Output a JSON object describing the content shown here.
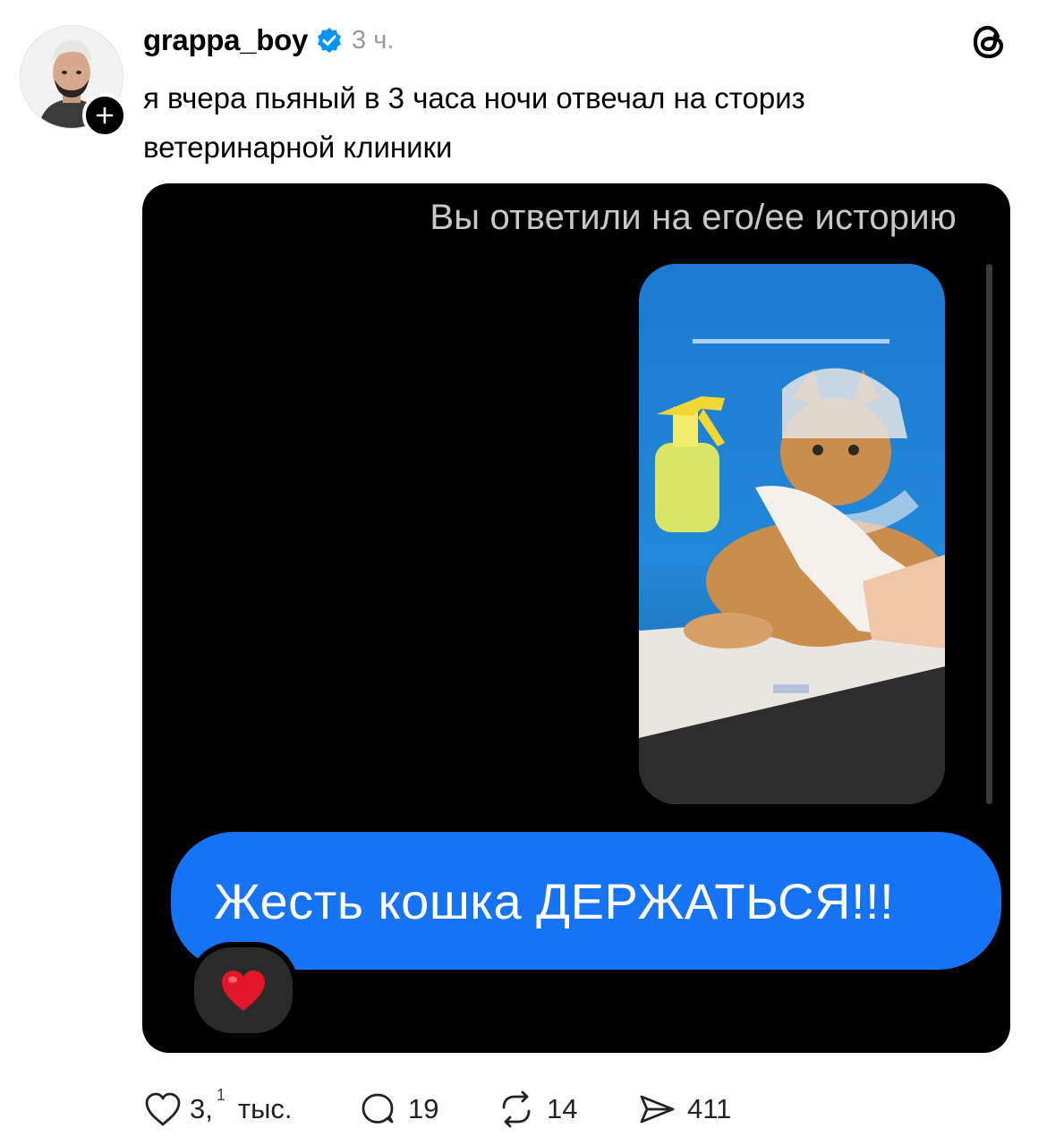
{
  "post": {
    "username": "grappa_boy",
    "time": "3 ч.",
    "text": "я вчера пьяный в 3 часа ночи отвечал на сториз ветеринарной клиники"
  },
  "media": {
    "header": "Вы ответили на его/ее историю",
    "reply": "Жесть кошка ДЕРЖАТЬСЯ!!!"
  },
  "actions": {
    "likes_main": "3,",
    "likes_sup": "1",
    "likes_unit": "тыс.",
    "comments": "19",
    "reposts": "14",
    "shares": "411"
  },
  "colors": {
    "verified": "#0095f6",
    "bubble": "#1673f3",
    "media_bg": "#000000"
  }
}
